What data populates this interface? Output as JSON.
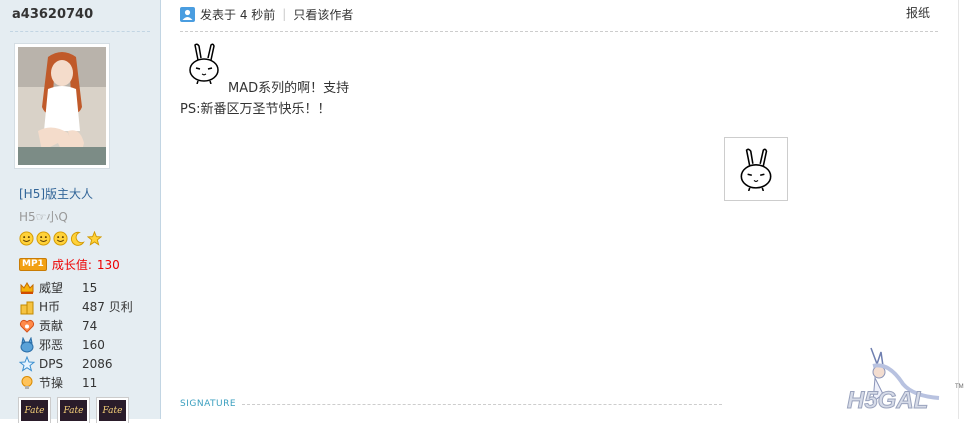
{
  "user": {
    "username": "a43620740",
    "rank_title": "[H5]版主大人",
    "custom_title": "H5☞小Q",
    "level_icons": [
      "smiley-icon",
      "smiley-icon",
      "smiley-icon",
      "moon-icon",
      "star-icon"
    ],
    "growth": {
      "badge": "MP1",
      "label": "成长值:",
      "value": "130"
    },
    "stats": [
      {
        "icon": "crown-icon",
        "label": "威望",
        "value": "15"
      },
      {
        "icon": "coin-icon",
        "label": "H币",
        "value": "487 贝利"
      },
      {
        "icon": "heart-icon",
        "label": "贡献",
        "value": "74"
      },
      {
        "icon": "devil-icon",
        "label": "邪恶",
        "value": "160"
      },
      {
        "icon": "star-outline-icon",
        "label": "DPS",
        "value": "2086"
      },
      {
        "icon": "bulb-icon",
        "label": "节操",
        "value": "11"
      }
    ],
    "medals": [
      "Fate",
      "Fate",
      "Fate"
    ]
  },
  "post": {
    "posted": "发表于 4 秒前",
    "author_only": "只看该作者",
    "report": "报纸",
    "message_line1": "MAD系列的啊！支持",
    "message_line2": "PS:新番区万圣节快乐！！",
    "signature_label": "SIGNATURE"
  },
  "watermark": "H5GAL",
  "colors": {
    "sidebar_bg": "#e5edf2",
    "rank_title": "#336699",
    "growth": "#ee0000",
    "signature": "#3a9fbf"
  }
}
